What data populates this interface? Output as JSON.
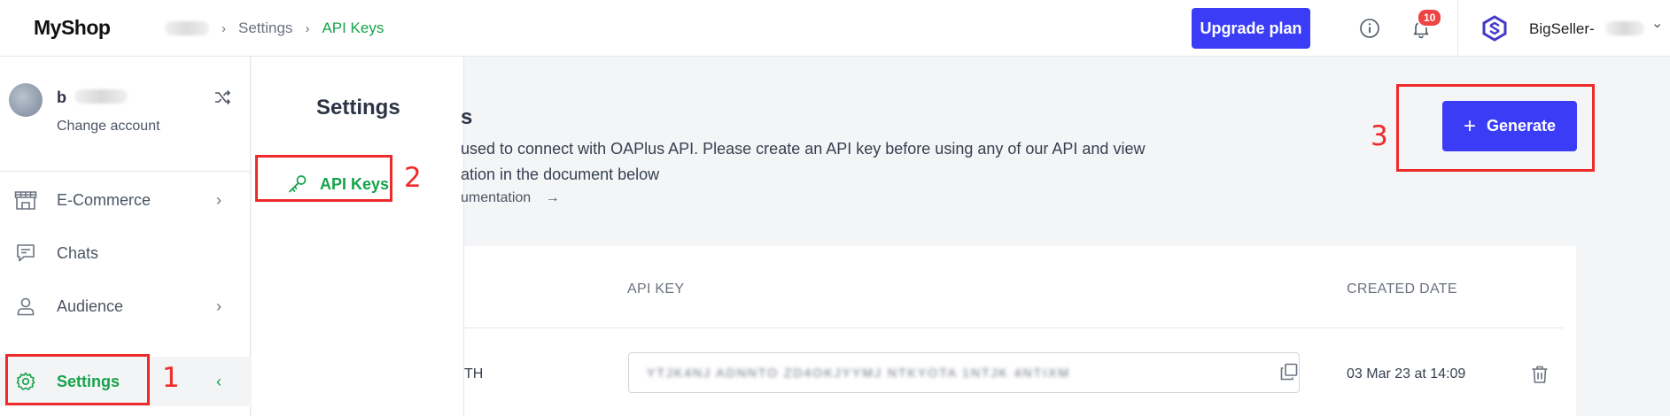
{
  "topbar": {
    "logo": "MyShop",
    "breadcrumb": [
      "Settings",
      "API Keys"
    ],
    "upgrade_label": "Upgrade plan",
    "notification_count": "10",
    "brand_name": "BigSeller-"
  },
  "sidebar": {
    "user_initial": "b",
    "change_account": "Change account",
    "items": [
      {
        "label": "E-Commerce",
        "icon": "store-icon",
        "has_chevron": true
      },
      {
        "label": "Chats",
        "icon": "chat-icon",
        "has_chevron": false
      },
      {
        "label": "Audience",
        "icon": "user-icon",
        "has_chevron": true
      },
      {
        "label": "Settings",
        "icon": "gear-icon",
        "active": true
      }
    ]
  },
  "submenu": {
    "title": "Settings",
    "items": [
      {
        "label": "API Keys",
        "icon": "key-icon",
        "active": true
      }
    ]
  },
  "main": {
    "title_fragment": "s",
    "description_line1": "used to connect with OAPlus API. Please create an API key before using any of our API and view",
    "description_line2": "ation in the document below",
    "doc_link": "umentation",
    "generate_label": "Generate",
    "table": {
      "headers": [
        "API KEY",
        "CREATED DATE"
      ],
      "rows": [
        {
          "name_fragment": "TH",
          "key": "YTJK4NJ  ADNNTO  ZD4OKJYYMJ  NTKYOTA  1NTJK   4NTIXM",
          "created": "03 Mar 23 at 14:09"
        }
      ]
    }
  },
  "annotations": [
    "1",
    "2",
    "3"
  ],
  "colors": {
    "accent_blue": "#3b3df6",
    "accent_green": "#16a34a",
    "annotation_red": "#ef2a2a"
  }
}
